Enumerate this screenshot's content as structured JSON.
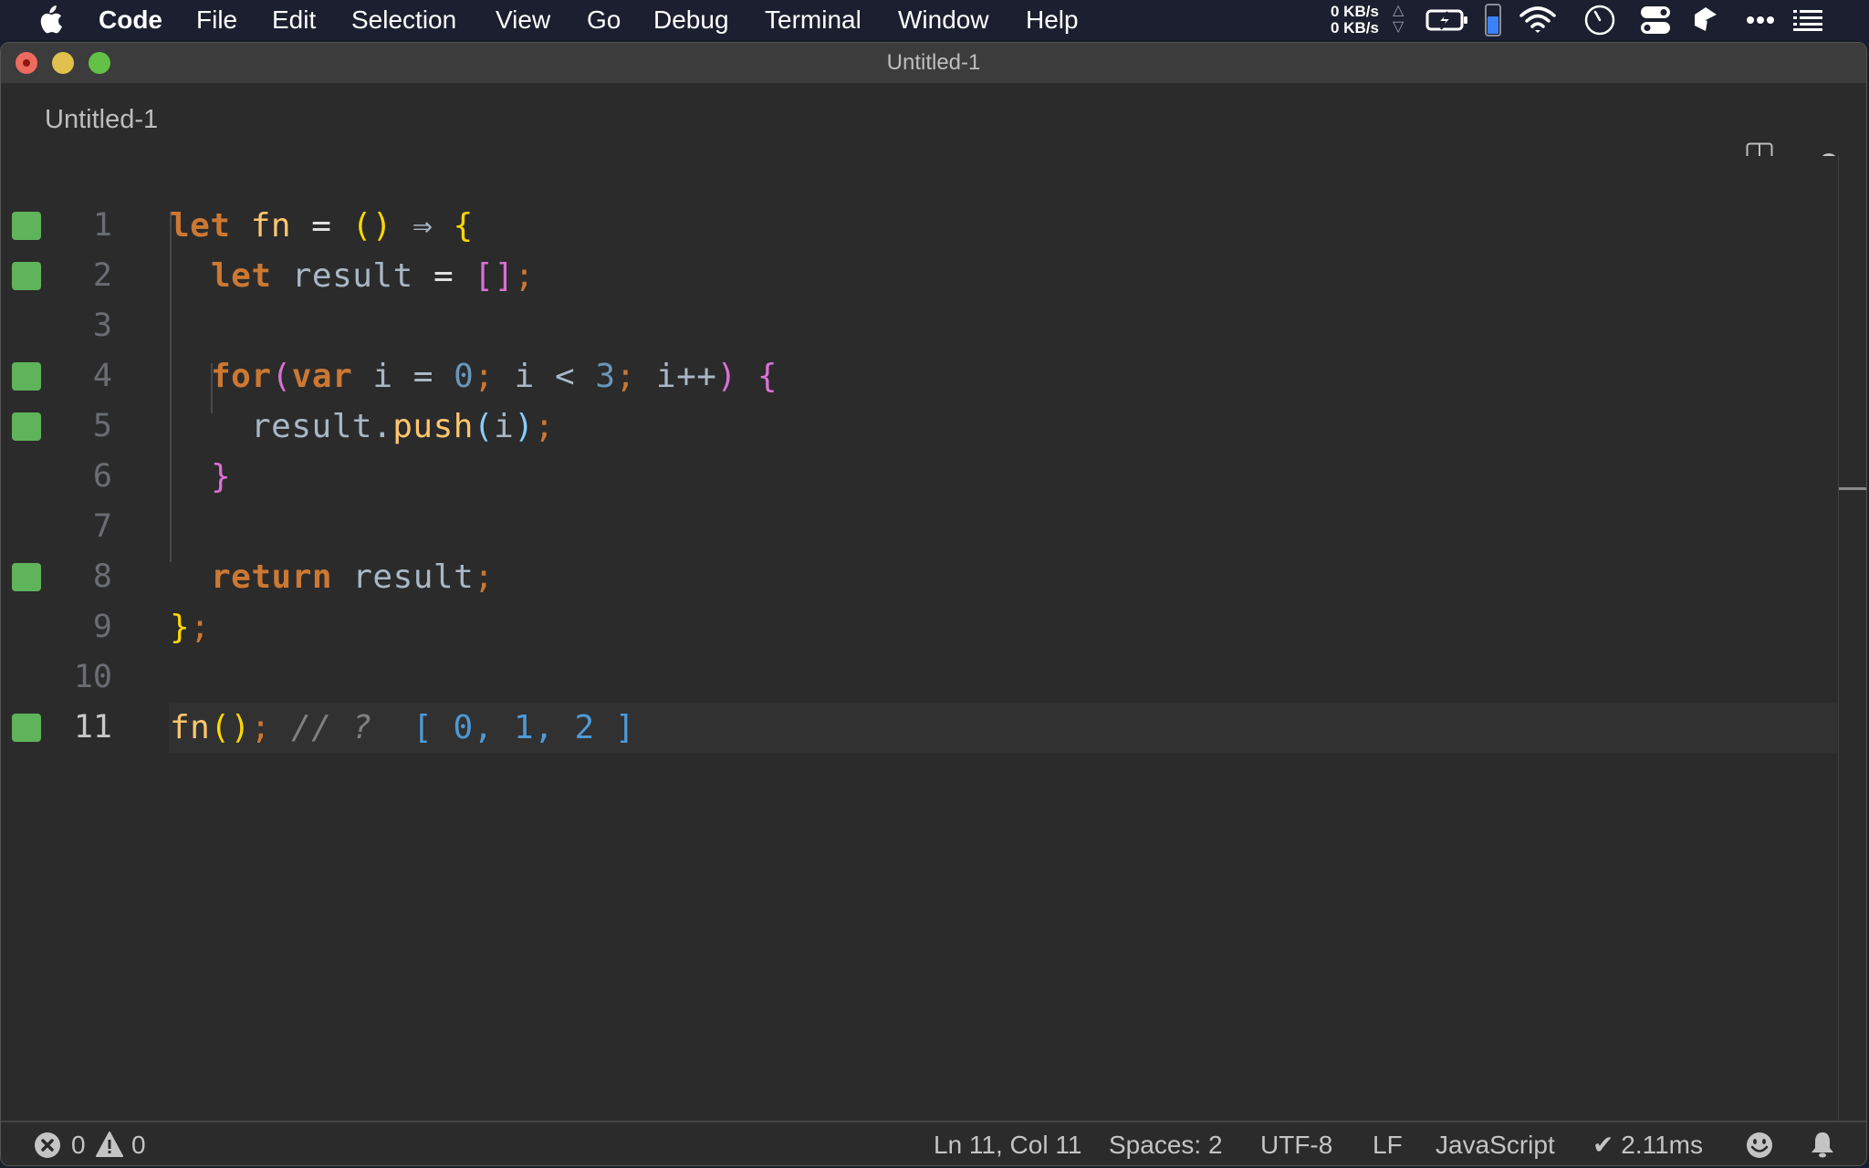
{
  "menubar": {
    "app_name": "Code",
    "items": [
      "File",
      "Edit",
      "Selection",
      "View",
      "Go",
      "Debug",
      "Terminal",
      "Window",
      "Help"
    ],
    "tray": {
      "upload_speed": "0 KB/s",
      "download_speed": "0 KB/s",
      "icons": [
        "battery-charging-icon",
        "memory-gauge-icon",
        "wifi-icon",
        "clock-icon",
        "toggle-icon",
        "app-icon",
        "more-icon",
        "list-icon"
      ]
    }
  },
  "window": {
    "title": "Untitled-1",
    "tab": {
      "label": "Untitled-1",
      "dirty": true
    }
  },
  "editor": {
    "lines": [
      {
        "number": "1",
        "covered": true
      },
      {
        "number": "2",
        "covered": true
      },
      {
        "number": "3",
        "covered": false
      },
      {
        "number": "4",
        "covered": true
      },
      {
        "number": "5",
        "covered": true
      },
      {
        "number": "6",
        "covered": false
      },
      {
        "number": "7",
        "covered": false
      },
      {
        "number": "8",
        "covered": true
      },
      {
        "number": "9",
        "covered": false
      },
      {
        "number": "10",
        "covered": false
      },
      {
        "number": "11",
        "covered": true,
        "current": true
      }
    ],
    "tokens": {
      "l1": [
        "let",
        " ",
        "fn",
        " = ",
        "(",
        ")",
        " ⇒ ",
        "{"
      ],
      "l2": [
        "let",
        " ",
        "result",
        " = ",
        "[",
        "]",
        ";"
      ],
      "l4": [
        "for",
        "(",
        "var",
        " i = ",
        "0",
        ";",
        " i < ",
        "3",
        ";",
        " i++",
        ")",
        " ",
        "{"
      ],
      "l5": [
        "result.",
        "push",
        "(",
        "i",
        ")",
        ";"
      ],
      "l6": [
        "}"
      ],
      "l8": [
        "return",
        " ",
        "result",
        ";"
      ],
      "l9": [
        "}",
        ";"
      ],
      "l11": [
        "fn",
        "(",
        ")",
        ";",
        " // ? ",
        " [ 0, 1, 2 ]"
      ]
    },
    "inline_result": "[ 0, 1, 2 ]",
    "colors": {
      "coverage": "#5fb35a",
      "keyword": "#cc7832",
      "function": "#ffc66d",
      "bracket_level1": "#ffd700",
      "bracket_level2": "#da70d6",
      "bracket_level3": "#87cefa",
      "number": "#6897bb",
      "result": "#4e9ad6"
    }
  },
  "statusbar": {
    "errors": "0",
    "warnings": "0",
    "position": "Ln 11, Col 11",
    "indent": "Spaces: 2",
    "encoding": "UTF-8",
    "eol": "LF",
    "language": "JavaScript",
    "timing": "✔ 2.11ms"
  }
}
